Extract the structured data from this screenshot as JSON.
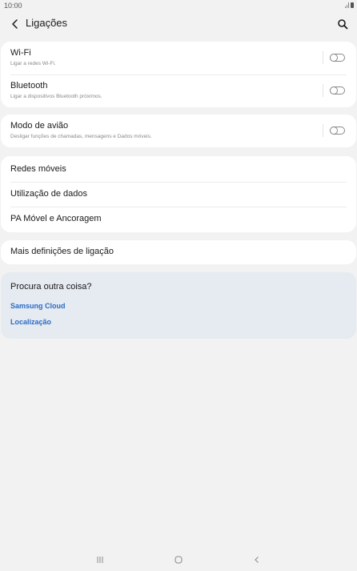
{
  "status_bar": {
    "time": "10:00"
  },
  "header": {
    "title": "Ligações"
  },
  "toggles": [
    {
      "title": "Wi-Fi",
      "subtitle": "Ligar a redes Wi-Fi.",
      "enabled": false
    },
    {
      "title": "Bluetooth",
      "subtitle": "Ligar a dispositivos Bluetooth próximos.",
      "enabled": false
    },
    {
      "title": "Modo de avião",
      "subtitle": "Desligar funções de chamadas, mensagens e Dados móveis.",
      "enabled": false
    }
  ],
  "menu": {
    "redes_moveis": "Redes móveis",
    "utilizacao_dados": "Utilização de dados",
    "pa_movel": "PA Móvel e Ancoragem",
    "mais_definicoes": "Mais definições de ligação"
  },
  "suggestions": {
    "title": "Procura outra coisa?",
    "links": [
      "Samsung Cloud",
      "Localização"
    ]
  },
  "colors": {
    "background": "#f2f2f2",
    "card": "#ffffff",
    "suggestion_card": "#e6eaf1",
    "link": "#2a6cc4"
  }
}
